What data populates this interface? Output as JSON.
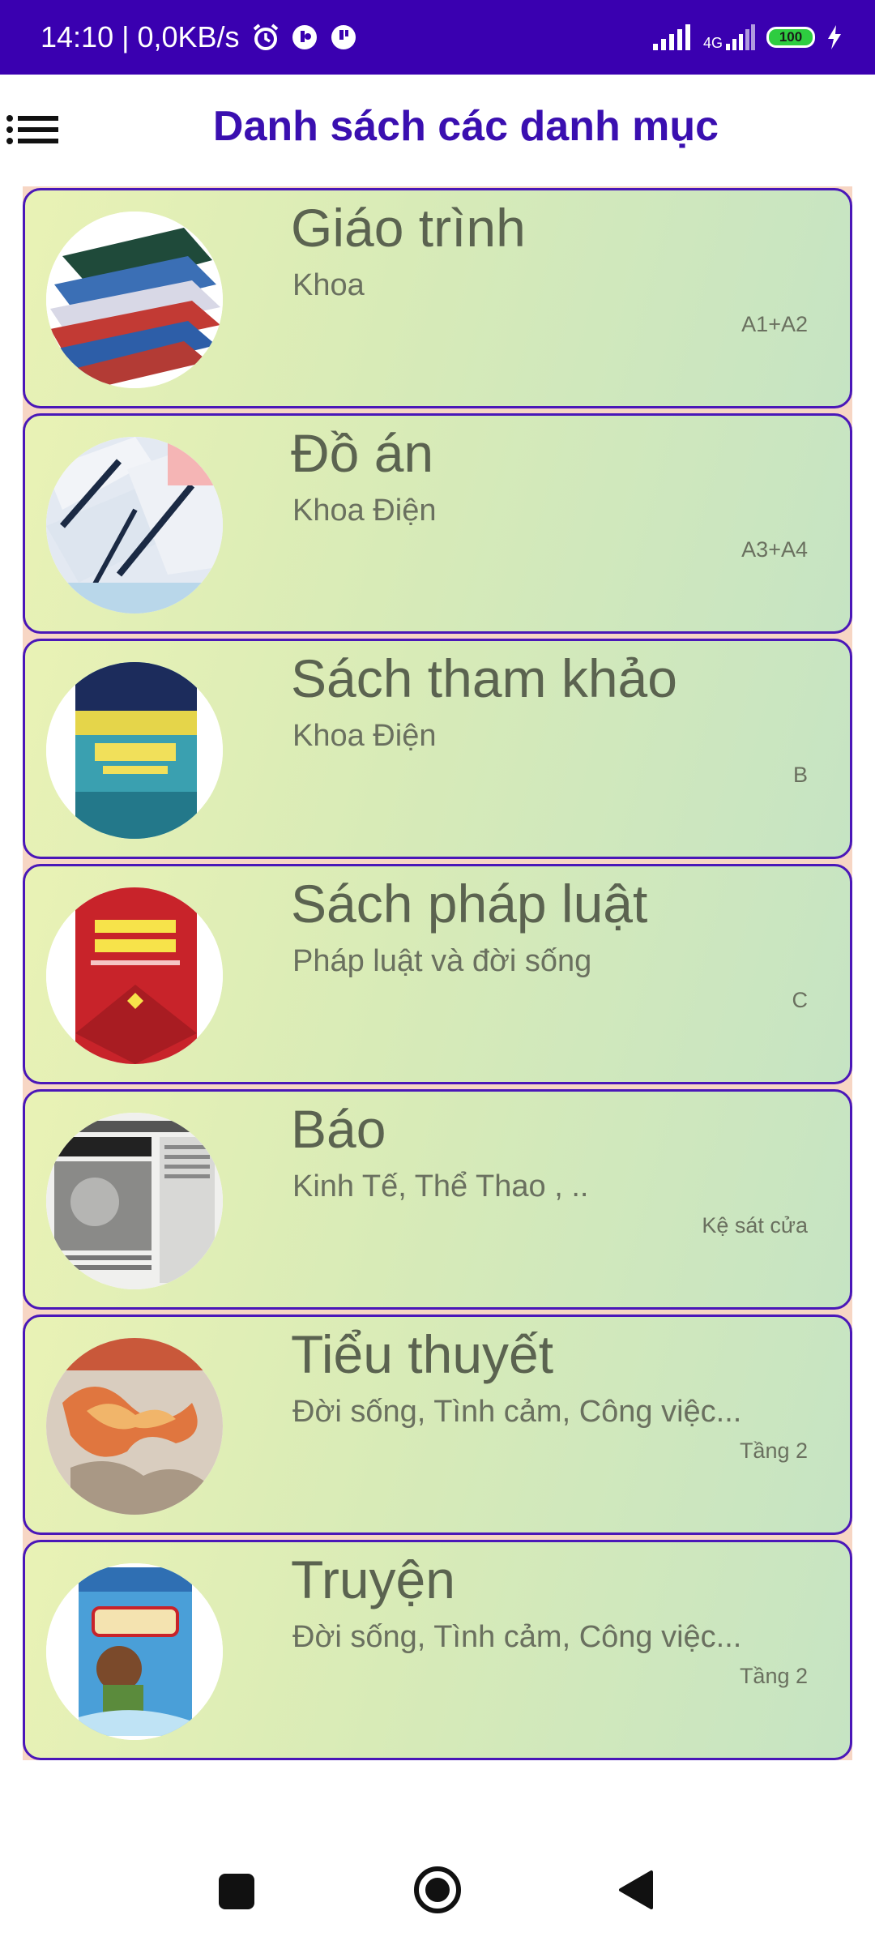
{
  "status_bar": {
    "time_text": "14:10 | 0,0KB/s",
    "network": "4G",
    "battery_level": "100",
    "icons": [
      "alarm-icon",
      "messenger-icon",
      "chat-icon",
      "signal-icon",
      "signal-4g-icon",
      "battery-icon",
      "charging-icon"
    ]
  },
  "header": {
    "title": "Danh sách các danh mục",
    "menu_icon": "hamburger-menu-icon"
  },
  "colors": {
    "accent": "#3a0fb0",
    "status_bar": "#3a00b0",
    "card_border": "#4a17b8",
    "text_primary": "#5b6350"
  },
  "categories": [
    {
      "title": "Giáo trình",
      "subtitle": "Khoa",
      "location": "A1+A2",
      "image": "stack-of-books-image"
    },
    {
      "title": "Đồ án",
      "subtitle": "Khoa Điện",
      "location": "A3+A4",
      "image": "project-papers-image"
    },
    {
      "title": "Sách tham khảo",
      "subtitle": "Khoa Điện",
      "location": "B",
      "image": "java-book-cover-image"
    },
    {
      "title": "Sách pháp luật",
      "subtitle": "Pháp luật và đời sống",
      "location": "C",
      "image": "law-book-cover-image"
    },
    {
      "title": "Báo",
      "subtitle": "Kinh Tế, Thể Thao , ..",
      "location": "Kệ sát cửa",
      "image": "newspaper-image"
    },
    {
      "title": "Tiểu thuyết",
      "subtitle": "Đời sống, Tình cảm, Công việc...",
      "location": "Tầng 2",
      "image": "novel-cover-image"
    },
    {
      "title": "Truyện",
      "subtitle": "Đời sống, Tình cảm, Công việc...",
      "location": "Tầng 2",
      "image": "story-book-cover-image"
    }
  ],
  "nav_bar": {
    "buttons": [
      "recents-button",
      "home-button",
      "back-button"
    ]
  }
}
